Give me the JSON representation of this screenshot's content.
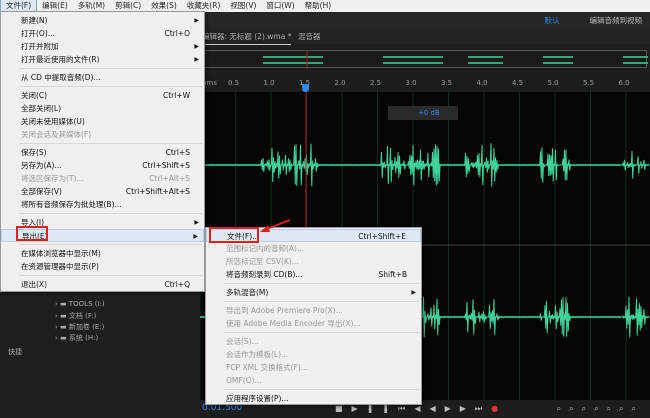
{
  "menubar": [
    "文件(F)",
    "编辑(E)",
    "多轨(M)",
    "剪辑(C)",
    "效果(S)",
    "收藏夹(R)",
    "视图(V)",
    "窗口(W)",
    "帮助(H)"
  ],
  "workspace": {
    "active": "默认",
    "other": "编辑音频到视频"
  },
  "tabs": {
    "editor": "编辑器: 无标题 (2).wma *",
    "mixer": "混音器"
  },
  "ruler": {
    "unit": "hms",
    "ticks": [
      "0.5",
      "1.0",
      "1.5",
      "2.0",
      "2.5",
      "3.0",
      "3.5",
      "4.0",
      "4.5",
      "5.0",
      "5.5",
      "6.0"
    ]
  },
  "hud": {
    "gain": "+0 dB"
  },
  "time": "0:01.500",
  "file_menu": [
    {
      "label": "新建(N)",
      "sub": true
    },
    {
      "label": "打开(O)...",
      "sc": "Ctrl+O"
    },
    {
      "label": "打开并附加",
      "sub": true
    },
    {
      "label": "打开最近使用的文件(R)",
      "sub": true
    },
    {
      "sep": true
    },
    {
      "label": "从 CD 中提取音频(D)..."
    },
    {
      "sep": true
    },
    {
      "label": "关闭(C)",
      "sc": "Ctrl+W"
    },
    {
      "label": "全部关闭(L)"
    },
    {
      "label": "关闭未使用媒体(U)"
    },
    {
      "label": "关闭会话及其媒体(F)",
      "dis": true
    },
    {
      "sep": true
    },
    {
      "label": "保存(S)",
      "sc": "Ctrl+S"
    },
    {
      "label": "另存为(A)...",
      "sc": "Ctrl+Shift+S"
    },
    {
      "label": "将选区保存为(T)...",
      "sc": "Ctrl+Alt+S",
      "dis": true
    },
    {
      "label": "全部保存(V)",
      "sc": "Ctrl+Shift+Alt+S"
    },
    {
      "label": "将所有音频保存为批处理(B)..."
    },
    {
      "sep": true
    },
    {
      "label": "导入(I)",
      "sub": true
    },
    {
      "label": "导出(E)",
      "sub": true,
      "hl": true
    },
    {
      "sep": true
    },
    {
      "label": "在媒体浏览器中显示(M)"
    },
    {
      "label": "在资源管理器中显示(P)"
    },
    {
      "sep": true
    },
    {
      "label": "退出(X)",
      "sc": "Ctrl+Q"
    }
  ],
  "export_menu": [
    {
      "label": "文件(F)...",
      "sc": "Ctrl+Shift+E",
      "hl": true
    },
    {
      "label": "范围标记内的音频(A)...",
      "dis": true
    },
    {
      "label": "所选标记至 CSV(K)...",
      "dis": true
    },
    {
      "label": "将音频刻录到 CD(B)...",
      "sc": "Shift+B"
    },
    {
      "sep": true
    },
    {
      "label": "多轨混音(M)",
      "sub": true
    },
    {
      "sep": true
    },
    {
      "label": "导出到 Adobe Premiere Pro(X)...",
      "dis": true
    },
    {
      "label": "使用 Adobe Media Encoder 导出(X)...",
      "dis": true
    },
    {
      "sep": true
    },
    {
      "label": "会话(S)...",
      "dis": true
    },
    {
      "label": "会话作为模板(L)...",
      "dis": true
    },
    {
      "label": "FCP XML 交换格式(F)...",
      "dis": true
    },
    {
      "label": "OMF(O)...",
      "dis": true
    },
    {
      "sep": true
    },
    {
      "label": "应用程序设置(P)..."
    }
  ],
  "drives": [
    "TOOLS (I:)",
    "文档 (F:)",
    "新加卷 (E:)",
    "系统 (H:)"
  ],
  "quick": "快捷",
  "colors": {
    "wave": "#3fd39a",
    "accent": "#2d8ceb",
    "highlight": "#e0201a"
  }
}
